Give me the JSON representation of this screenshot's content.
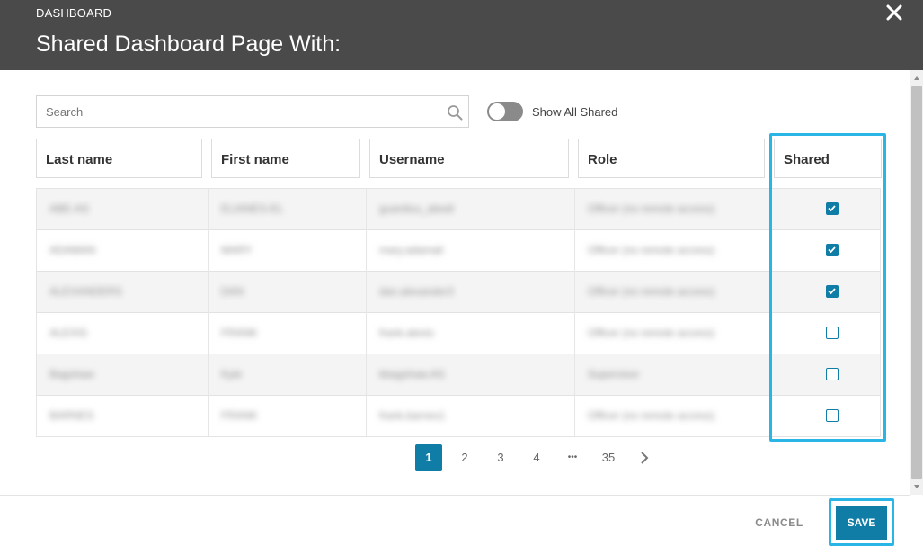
{
  "header": {
    "eyebrow": "DASHBOARD",
    "title": "Shared Dashboard Page With:",
    "close_icon": "close-icon"
  },
  "search": {
    "placeholder": "Search",
    "value": "",
    "icon": "search-icon"
  },
  "toggle": {
    "label": "Show All Shared",
    "on": false
  },
  "table": {
    "columns": [
      "Last name",
      "First name",
      "Username",
      "Role",
      "Shared"
    ],
    "rows": [
      {
        "last": "ABE-AS",
        "first": "ELIANES-EL",
        "username": "guardiou_abedl",
        "role": "Officer (no remote access)",
        "shared": true
      },
      {
        "last": "ADAMAN",
        "first": "MARY",
        "username": "mary.adamali",
        "role": "Officer (no remote access)",
        "shared": true
      },
      {
        "last": "ALEXANDERS",
        "first": "DAN",
        "username": "dan.alexander3",
        "role": "Officer (no remote access)",
        "shared": true
      },
      {
        "last": "ALEXIS",
        "first": "FRANK",
        "username": "frank.alexis",
        "role": "Officer (no remote access)",
        "shared": false
      },
      {
        "last": "Bagshaw",
        "first": "Kyle",
        "username": "kbagshaw.AS",
        "role": "Supervisor",
        "shared": false
      },
      {
        "last": "BARNES",
        "first": "FRANK",
        "username": "frank.barnes1",
        "role": "Officer (no remote access)",
        "shared": false
      }
    ]
  },
  "pagination": {
    "pages": [
      "1",
      "2",
      "3",
      "4",
      "•••",
      "35"
    ],
    "current": "1",
    "next_icon": "chevron-right-icon"
  },
  "footer": {
    "cancel_label": "CANCEL",
    "save_label": "SAVE"
  },
  "colors": {
    "header_bg": "#4a4a4a",
    "accent": "#0f7da6",
    "highlight": "#29b6e6"
  }
}
